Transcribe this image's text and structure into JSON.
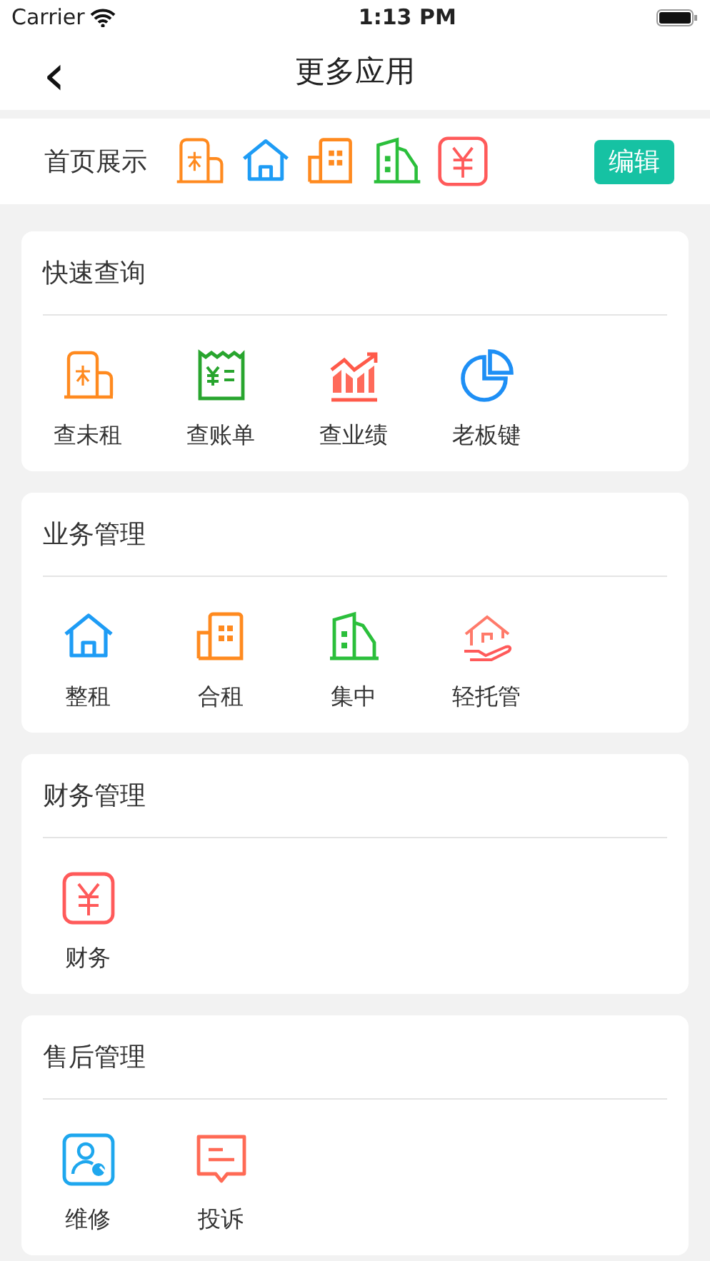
{
  "status_bar": {
    "carrier": "Carrier",
    "time": "1:13 PM"
  },
  "nav": {
    "back": "‹",
    "title": "更多应用"
  },
  "home_display": {
    "label": "首页展示",
    "icons": [
      {
        "kind": "rent"
      },
      {
        "kind": "house"
      },
      {
        "kind": "office"
      },
      {
        "kind": "tower"
      },
      {
        "kind": "yen"
      }
    ],
    "button": "编辑"
  },
  "sections": [
    {
      "title": "快速查询",
      "items": [
        {
          "kind": "rent",
          "label": "查未租"
        },
        {
          "kind": "receipt",
          "label": "查账单"
        },
        {
          "kind": "chart",
          "label": "查业绩"
        },
        {
          "kind": "pie",
          "label": "老板键"
        }
      ]
    },
    {
      "title": "业务管理",
      "items": [
        {
          "kind": "house",
          "label": "整租"
        },
        {
          "kind": "office",
          "label": "合租"
        },
        {
          "kind": "tower",
          "label": "集中"
        },
        {
          "kind": "handhouse",
          "label": "轻托管"
        }
      ]
    },
    {
      "title": "财务管理",
      "items": [
        {
          "kind": "yen",
          "label": "财务"
        }
      ]
    },
    {
      "title": "售后管理",
      "items": [
        {
          "kind": "repair",
          "label": "维修"
        },
        {
          "kind": "complaint",
          "label": "投诉"
        }
      ]
    }
  ]
}
